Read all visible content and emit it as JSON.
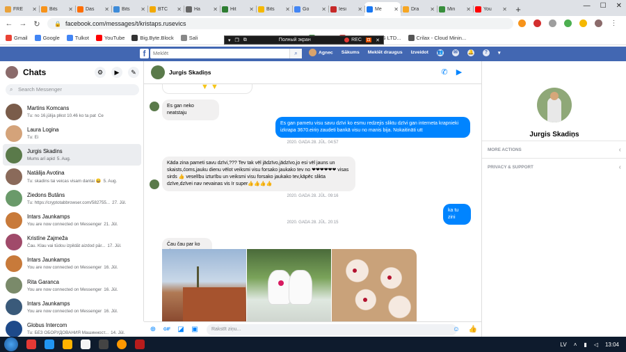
{
  "browser": {
    "tabs": [
      {
        "title": "FRE",
        "color": "#e9a23b"
      },
      {
        "title": "Bits",
        "color": "#f7931a"
      },
      {
        "title": "Das",
        "color": "#ff6d00"
      },
      {
        "title": "Bits",
        "color": "#3d8bd9"
      },
      {
        "title": "BTC",
        "color": "#f2a900"
      },
      {
        "title": "Ha",
        "color": "#666666"
      },
      {
        "title": "Hit",
        "color": "#2e7d32"
      },
      {
        "title": "Bits",
        "color": "#f5b800"
      },
      {
        "title": "Go",
        "color": "#4285f4"
      },
      {
        "title": "Iesi",
        "color": "#c62828"
      },
      {
        "title": "Me",
        "color": "#1877f2"
      },
      {
        "title": "Dra",
        "color": "#f6a623"
      },
      {
        "title": "Min",
        "color": "#388e3c"
      },
      {
        "title": "You",
        "color": "#ff0000"
      }
    ],
    "active_tab_index": 10,
    "url": "facebook.com/messages/t/kristaps.rusevics",
    "bookmarks": [
      {
        "label": "Gmail",
        "color": "#ea4335"
      },
      {
        "label": "Google",
        "color": "#4285f4"
      },
      {
        "label": "Tulkot",
        "color": "#4285f4"
      },
      {
        "label": "YouTube",
        "color": "#ff0000"
      },
      {
        "label": "Big.Byte.Block",
        "color": "#333333"
      },
      {
        "label": "Sali",
        "color": "#888888"
      },
      {
        "label": "HitBits",
        "color": "#2e7d32"
      },
      {
        "label": "FRESH MINING LTD...",
        "color": "#c62828"
      },
      {
        "label": "Crilax - Cloud Minin...",
        "color": "#555555"
      }
    ]
  },
  "video_overlay": {
    "fullscreen_label": "Полный экран",
    "rec_label": "REC"
  },
  "fb_header": {
    "search_placeholder": "Meklēt",
    "nav": [
      "Agnес",
      "Sākums",
      "Meklēt draugus",
      "Izveidot"
    ]
  },
  "left_panel": {
    "title": "Chats",
    "search_placeholder": "Search Messenger",
    "conversations": [
      {
        "name": "Martins Komcans",
        "preview": "Tu: no 16.jūlija plkst 10.46 ko ta pat",
        "date": "Ce",
        "color": "#7a5c4a"
      },
      {
        "name": "Laura Logina",
        "preview": "Tu: Ei",
        "date": "",
        "color": "#d4a37a"
      },
      {
        "name": "Jurgis Skadins",
        "preview": "Mums arī apid",
        "date": "5. Aug.",
        "color": "#5a7a4a"
      },
      {
        "name": "Natālija Avotina",
        "preview": "Tu: skadins tai veicas visam dantai 😀",
        "date": "5. Aug.",
        "color": "#8a6a5a"
      },
      {
        "name": "Ziedons Butāns",
        "preview": "Tu: https://cryptotabbrowser.com/582755...",
        "date": "27. Jūl.",
        "color": "#6a9a6a"
      },
      {
        "name": "Intars Jaunkamps",
        "preview": "You are now connected on Messenger",
        "date": "21. Jūl.",
        "color": "#c87a3a"
      },
      {
        "name": "Kristīne Zajmeža",
        "preview": "Čau. Klau vai tūdou izpildāt aizdod pār...",
        "date": "17. Jūl.",
        "color": "#a04a6a"
      },
      {
        "name": "Intars Jaunkamps",
        "preview": "You are now connected on Messenger",
        "date": "16. Jūl.",
        "color": "#c87a3a"
      },
      {
        "name": "Rita Garanca",
        "preview": "You are now connected on Messenger",
        "date": "16. Jūl.",
        "color": "#7a8a6a"
      },
      {
        "name": "Intars Jaunkamps",
        "preview": "You are now connected on Messenger",
        "date": "16. Jūl.",
        "color": "#3a5a7a"
      },
      {
        "name": "Globus Intercom",
        "preview": "Tu: БЕЗ ОБОРУДОВАНИЯ Машинност...",
        "date": "14. Jūl.",
        "color": "#1e4a8a"
      }
    ],
    "selected_index": 2
  },
  "chat": {
    "contact_name": "Jurgis Skadiņs",
    "messages": [
      {
        "dir": "in",
        "text": "Es gan neko neatstaju"
      },
      {
        "dir": "out",
        "text": "Es gan pametu visu savu dzīvi ko esmu redzejis sliktu dzīvi gan interneta krapnieki izkrapa 3670.eiriņ zaudeti bankā visu no manis bija. Nokaitināti utt"
      },
      {
        "dir": "in",
        "text": "Kāda zina pameti savu dzīvi,??? Tev tak vēl jādzīvo,jādzīvo,jo esi vēl jauns un skaists,ćoms,jauku dienu vēlot veiksmi visu forsako jaukako tev no ❤❤❤❤❤❤ visas sirds 👍 veselību izturību un veiksmi visu forsako jaukako tev,kāpēc slikta dzīve,dzīvei nav nevainas vis Ir super👍👍👍👍"
      },
      {
        "dir": "out",
        "text": "ka tu zini"
      },
      {
        "dir": "in",
        "text": "Čau čau par ko zinu"
      }
    ],
    "timestamps": [
      "2020. GADA 28. JŪL. 04:57",
      "2020. GADA 28. JŪL. 09:16",
      "2020. GADA 28. JŪL. 20:15"
    ],
    "composer_placeholder": "Rakstīt ziņu..."
  },
  "right_panel": {
    "name": "Jurgis Skadiņs",
    "sections": [
      "MORE ACTIONS",
      "PRIVACY & SUPPORT"
    ]
  },
  "taskbar": {
    "lang": "LV",
    "time": "13:04"
  }
}
